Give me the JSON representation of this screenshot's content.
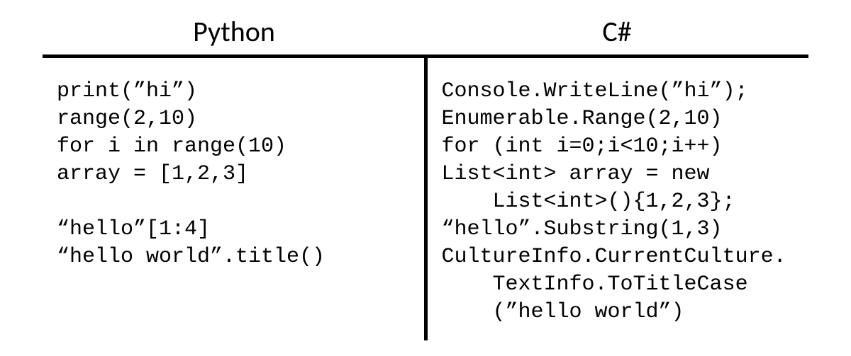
{
  "headers": {
    "left": "Python",
    "right": "C#"
  },
  "code": {
    "python": "print(”hi”)\nrange(2,10)\nfor i in range(10)\narray = [1,2,3]\n\n“hello”[1:4]\n“hello world”.title()",
    "csharp": "Console.WriteLine(”hi”);\nEnumerable.Range(2,10)\nfor (int i=0;i<10;i++)\nList<int> array = new\n    List<int>(){1,2,3};\n“hello”.Substring(1,3)\nCultureInfo.CurrentCulture.\n    TextInfo.ToTitleCase\n    (”hello world”)"
  }
}
